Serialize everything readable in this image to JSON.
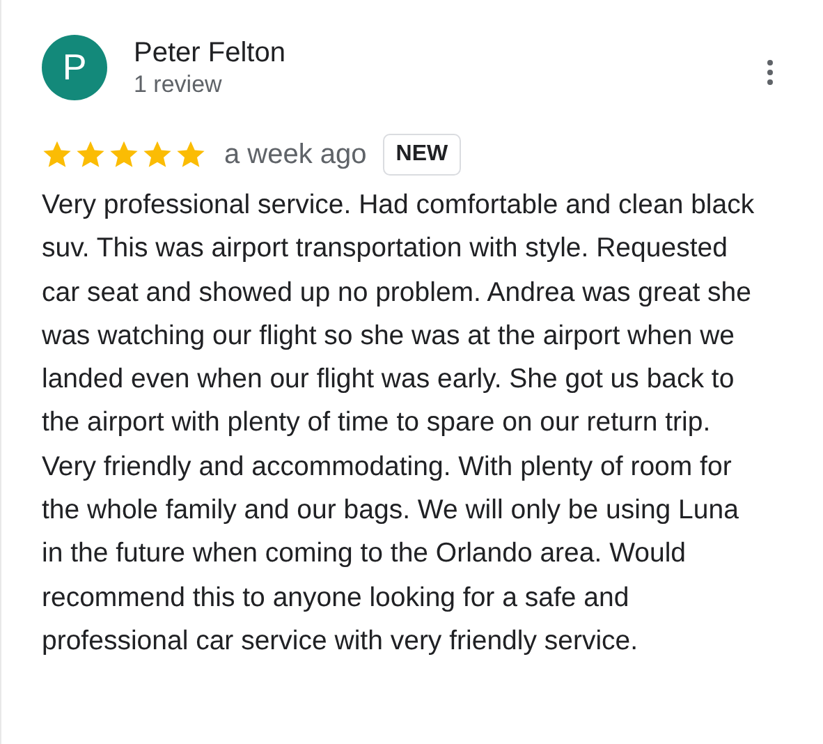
{
  "review": {
    "avatar_letter": "P",
    "author": "Peter Felton",
    "review_count": "1 review",
    "stars": 5,
    "time": "a week ago",
    "badge": "NEW",
    "text": "Very professional service. Had comfortable and clean black suv. This was airport transportation with style. Requested car seat and showed up no problem. Andrea was great she was watching our flight so she was at the airport when we landed even when our flight was early. She got us back to the airport with plenty of time to spare on our return trip. Very friendly and accommodating. With plenty of room for the whole family and our bags. We will only be using Luna in the future when coming to the Orlando area. Would recommend this to anyone looking for a safe and professional car service with very friendly service."
  }
}
